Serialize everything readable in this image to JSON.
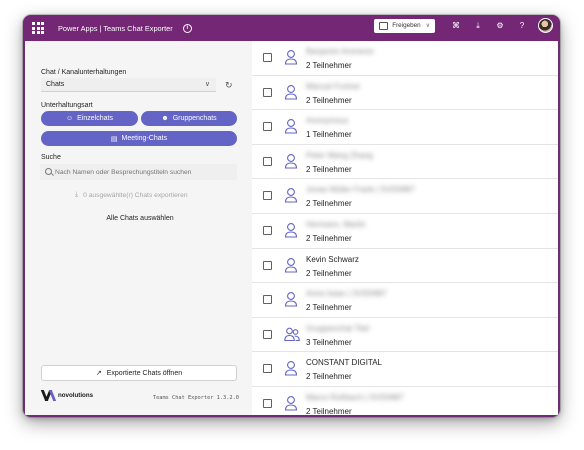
{
  "topbar": {
    "app_title": "Power Apps  |  Teams Chat Exporter",
    "share_label": "Freigeben",
    "icons": [
      "waffle-icon",
      "info-icon",
      "share-icon",
      "chevron-down-icon",
      "flow-icon",
      "download-icon",
      "settings-icon",
      "help-icon"
    ],
    "help_glyph": "?"
  },
  "sidebar": {
    "chat_section_label": "Chat / Kanalunterhaltungen",
    "chat_type_value": "Chats",
    "conversation_type_label": "Unterhaltungsart",
    "btn_individual": "Einzelchats",
    "btn_group": "Gruppenchats",
    "btn_meeting": "Meeting-Chats",
    "search_label": "Suche",
    "search_placeholder": "Nach Namen oder Besprechungstiteln suchen",
    "export_label": "0 ausgewählte(r) Chats exportieren",
    "select_all_label": "Alle Chats auswählen",
    "open_exported_label": "Exportierte Chats öffnen",
    "logo_text": "novolutions",
    "version": "Teams Chat Exporter 1.3.2.0"
  },
  "chats": [
    {
      "name": "Benjamin Ammerer",
      "participants": "2 Teilnehmer",
      "blurred": true,
      "icon": "person-icon"
    },
    {
      "name": "Manuel Furtner",
      "participants": "2 Teilnehmer",
      "blurred": true,
      "icon": "person-icon"
    },
    {
      "name": "Anonymous",
      "participants": "1 Teilnehmer",
      "blurred": true,
      "icon": "person-icon"
    },
    {
      "name": "Peter Wang Zhang",
      "participants": "2 Teilnehmer",
      "blurred": true,
      "icon": "person-icon"
    },
    {
      "name": "Jonas Müller Frank | SVD0987",
      "participants": "2 Teilnehmer",
      "blurred": true,
      "icon": "person-icon"
    },
    {
      "name": "Hermann, Martin",
      "participants": "2 Teilnehmer",
      "blurred": true,
      "icon": "person-icon"
    },
    {
      "name": "Kevin Schwarz",
      "participants": "2 Teilnehmer",
      "blurred": false,
      "icon": "person-icon"
    },
    {
      "name": "Anna Isaac | SVD0987",
      "participants": "2 Teilnehmer",
      "blurred": true,
      "icon": "person-icon"
    },
    {
      "name": "Gruppenchat Titel",
      "participants": "3 Teilnehmer",
      "blurred": true,
      "icon": "group-icon"
    },
    {
      "name": "CONSTANT DIGITAL",
      "participants": "2 Teilnehmer",
      "blurred": false,
      "icon": "person-icon"
    },
    {
      "name": "Marco Roßbach | SVD0987",
      "participants": "2 Teilnehmer",
      "blurred": true,
      "icon": "person-icon"
    }
  ],
  "colors": {
    "topbar": "#742774",
    "accent": "#6364c5",
    "sidebar_bg": "#f5f5f5"
  }
}
